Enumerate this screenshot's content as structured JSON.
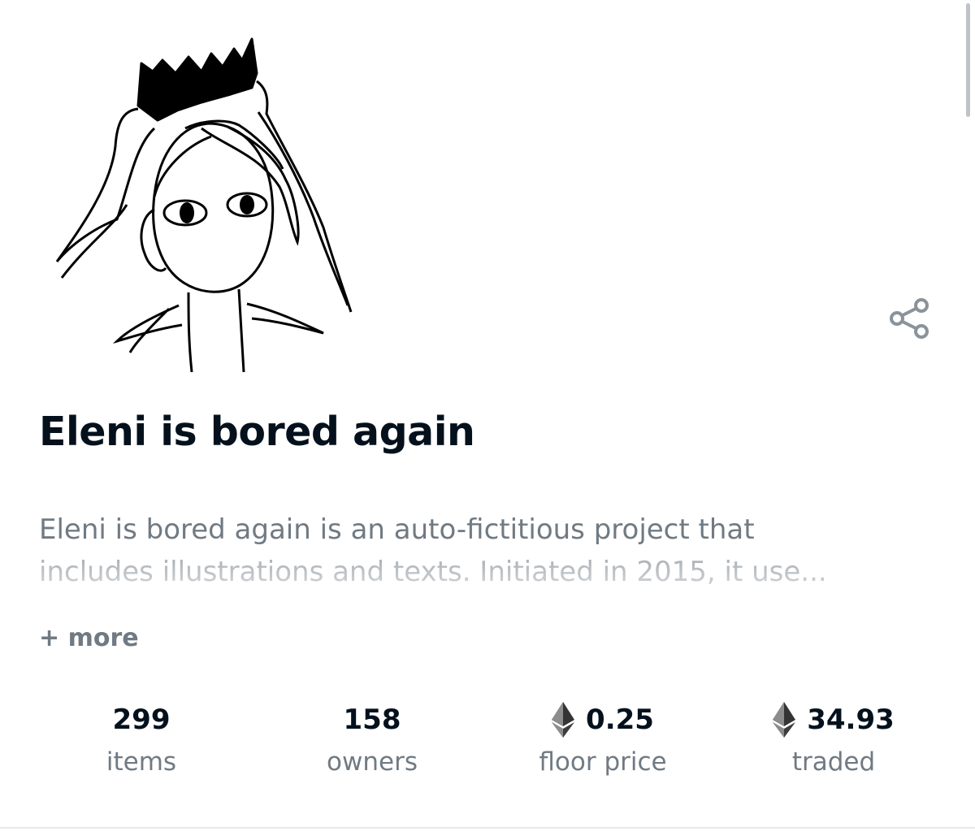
{
  "collection": {
    "title": "Eleni is bored again",
    "description_lines": [
      "Eleni is bored again is an auto-fictitious project that",
      "includes illustrations and texts. Initiated in 2015, it use..."
    ],
    "more_label": "+ more",
    "avatar_icon": "crowned-woman-drawing",
    "share_icon": "share-icon"
  },
  "stats": [
    {
      "value": "299",
      "label": "items",
      "currency_icon": null
    },
    {
      "value": "158",
      "label": "owners",
      "currency_icon": null
    },
    {
      "value": "0.25",
      "label": "floor price",
      "currency_icon": "ethereum-icon"
    },
    {
      "value": "34.93",
      "label": "traded",
      "currency_icon": "ethereum-icon"
    }
  ],
  "colors": {
    "title": "#04111d",
    "muted_text": "#707a83",
    "icon": "#8a939b",
    "background": "#ffffff"
  }
}
